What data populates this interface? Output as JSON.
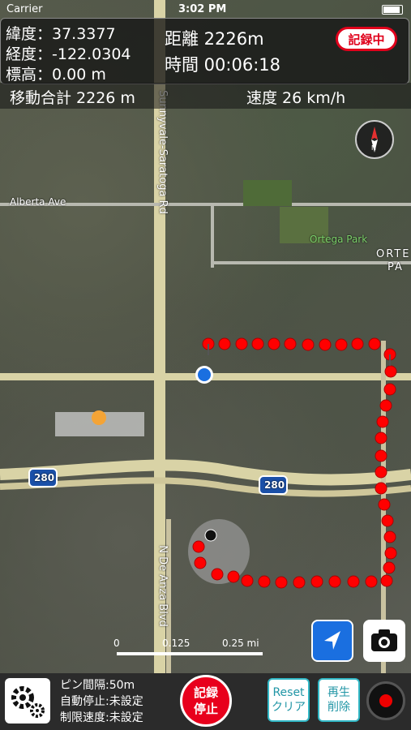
{
  "status_bar": {
    "carrier": "Carrier",
    "time": "3:02 PM"
  },
  "info": {
    "latitude": "緯度：37.3377",
    "longitude": "経度：-122.0304",
    "altitude": "標高：0.00 m",
    "distance": "距離 2226m",
    "elapsed_time": "時間 00:06:18",
    "recording_badge": "記録中"
  },
  "summary": {
    "total_distance": "移動合計 2226 m",
    "speed": "速度 26 km/h"
  },
  "map": {
    "labels": {
      "alberta_ave": "Alberta Ave",
      "sunnyvale_saratoga": "Sunnyvale-Saratoga Rd",
      "ortega_park": "Ortega Park",
      "orte": "ORTE",
      "pa": "PA",
      "n_de_anza": "N De Anza Blvd",
      "highway_280_a": "280",
      "highway_280_b": "280"
    },
    "scale": {
      "zero": "0",
      "mid": "0.125",
      "end": "0.25 mi"
    },
    "route_color": "#ff0000",
    "current_location_color": "#1a6fe0"
  },
  "controls": {
    "location_icon": "location-arrow-icon",
    "camera_icon": "camera-icon",
    "settings_icon": "gear-icon"
  },
  "bottom": {
    "pin_interval": "ピン間隔:50m",
    "auto_stop": "自動停止:未設定",
    "speed_limit": "制限速度:未設定",
    "stop_line1": "記録",
    "stop_line2": "停止",
    "reset_line1": "Reset",
    "reset_line2": "クリア",
    "play_line1": "再生",
    "play_line2": "削除"
  }
}
